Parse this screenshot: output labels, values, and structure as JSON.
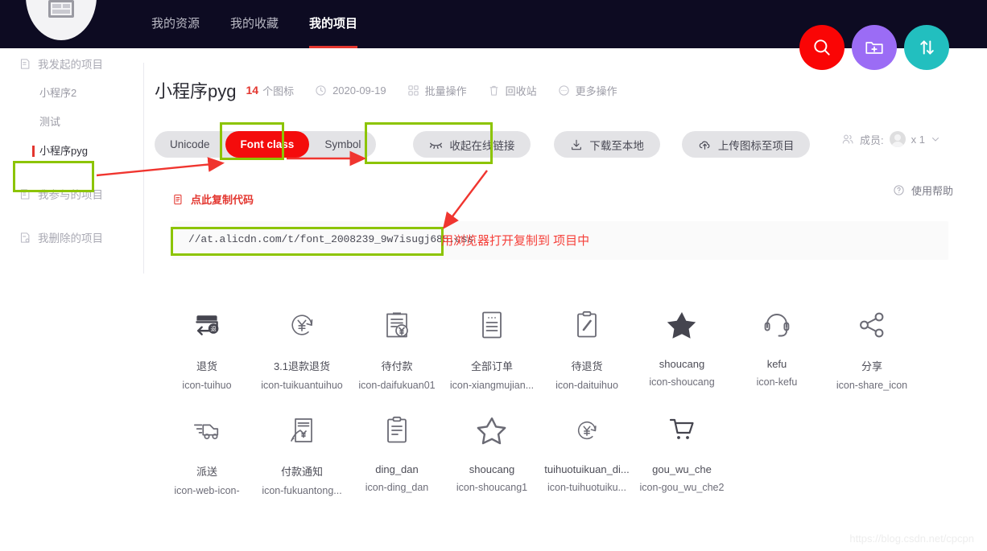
{
  "nav": {
    "logo_name": "iconfont-logo",
    "tabs": [
      {
        "label": "我的资源",
        "active": false
      },
      {
        "label": "我的收藏",
        "active": false
      },
      {
        "label": "我的项目",
        "active": true
      }
    ],
    "circle_buttons": [
      {
        "name": "search-icon",
        "label": "搜索",
        "color": "#fa0505"
      },
      {
        "name": "new-folder-icon",
        "label": "新建项目",
        "color": "#9b6cf5"
      },
      {
        "name": "sort-arrows-icon",
        "label": "排序",
        "color": "#22bfbf"
      }
    ]
  },
  "sidebar": {
    "groups": [
      {
        "label": "我发起的项目",
        "icon": "project-started-icon",
        "children": [
          {
            "label": "小程序2",
            "selected": false
          },
          {
            "label": "测试",
            "selected": false
          },
          {
            "label": "小程序pyg",
            "selected": true
          }
        ]
      },
      {
        "label": "我参与的项目",
        "icon": "project-joined-icon",
        "children": []
      },
      {
        "label": "我删除的项目",
        "icon": "project-deleted-icon",
        "children": []
      }
    ]
  },
  "project": {
    "title": "小程序pyg",
    "icon_count": "14",
    "icon_count_unit": "个图标",
    "date": "2020-09-19",
    "date_icon": "clock-icon",
    "actions": [
      {
        "label": "批量操作",
        "icon": "batch-icon"
      },
      {
        "label": "回收站",
        "icon": "trash-icon"
      },
      {
        "label": "更多操作",
        "icon": "more-icon"
      }
    ],
    "members_label": "成员:",
    "members_count": "x 1",
    "members_icon": "members-icon",
    "avatar_name": "member-avatar",
    "chevron": "chevron-down-icon"
  },
  "toolbar": {
    "format_tabs": [
      {
        "label": "Unicode",
        "active": false
      },
      {
        "label": "Font class",
        "active": true
      },
      {
        "label": "Symbol",
        "active": false
      }
    ],
    "collapse_link_button": {
      "label": "收起在线链接",
      "icon": "eye-closed-icon"
    },
    "download_button": {
      "label": "下载至本地",
      "icon": "download-icon"
    },
    "upload_button": {
      "label": "上传图标至项目",
      "icon": "upload-cloud-icon"
    },
    "help_link": {
      "label": "使用帮助",
      "icon": "question-circle-icon"
    }
  },
  "code_panel": {
    "copy_label": "点此复制代码",
    "copy_icon": "copy-icon",
    "css_url": "//at.alicdn.com/t/font_2008239_9w7isugj685.css"
  },
  "annotation": {
    "note_text": "用浏览器打开复制到 项目中",
    "box_color": "#8cc400",
    "arrow_color": "#f0352f"
  },
  "icons": [
    {
      "name": "退货",
      "class": "icon-tuihuo",
      "glyph": "return-box-icon"
    },
    {
      "name": "3.1退款退货",
      "class": "icon-tuikuantuihuo",
      "glyph": "refund-circle-icon"
    },
    {
      "name": "待付款",
      "class": "icon-daifukuan01",
      "glyph": "clipboard-yuan-icon"
    },
    {
      "name": "全部订单",
      "class": "icon-xiangmujian...",
      "glyph": "document-lines-icon"
    },
    {
      "name": "待退货",
      "class": "icon-daituihuo",
      "glyph": "clipboard-pen-icon"
    },
    {
      "name": "shoucang",
      "class": "icon-shoucang",
      "glyph": "star-filled-icon"
    },
    {
      "name": "kefu",
      "class": "icon-kefu",
      "glyph": "headset-icon"
    },
    {
      "name": "分享",
      "class": "icon-share_icon",
      "glyph": "share-nodes-icon"
    },
    {
      "name": "派送",
      "class": "icon-web-icon-",
      "glyph": "delivery-truck-icon"
    },
    {
      "name": "付款通知",
      "class": "icon-fukuantong...",
      "glyph": "payment-notice-icon"
    },
    {
      "name": "ding_dan",
      "class": "icon-ding_dan",
      "glyph": "clipboard-list-icon"
    },
    {
      "name": "shoucang",
      "class": "icon-shoucang1",
      "glyph": "star-outline-icon"
    },
    {
      "name": "tuihuotuikuan_di...",
      "class": "icon-tuihuotuiku...",
      "glyph": "refund-circle-small-icon"
    },
    {
      "name": "gou_wu_che",
      "class": "icon-gou_wu_che2",
      "glyph": "shopping-cart-icon"
    }
  ],
  "watermark": "https://blog.csdn.net/cpcpn"
}
